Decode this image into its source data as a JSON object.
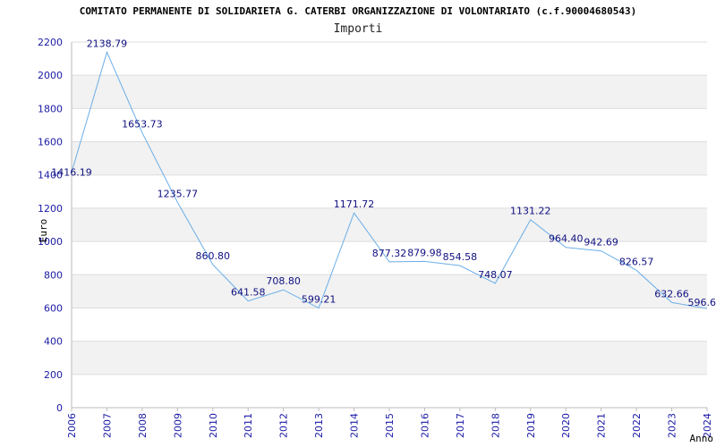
{
  "header": {
    "title": "COMITATO PERMANENTE DI SOLIDARIETA G. CATERBI ORGANIZZAZIONE DI VOLONTARIATO (c.f.90004680543)",
    "subtitle": "Importi"
  },
  "colors": {
    "line": "#6aaee8",
    "band": "#f2f2f2",
    "grid": "#dddddd",
    "tick_text": "#1a1aa6",
    "data_label": "#101080"
  },
  "chart_data": {
    "type": "line",
    "title": "COMITATO PERMANENTE DI SOLIDARIETA G. CATERBI ORGANIZZAZIONE DI VOLONTARIATO (c.f.90004680543)",
    "subtitle": "Importi",
    "xlabel": "Anno",
    "ylabel": "Euro",
    "ylim": [
      0,
      2200
    ],
    "yticks": [
      0,
      200,
      400,
      600,
      800,
      1000,
      1200,
      1400,
      1600,
      1800,
      2000,
      2200
    ],
    "categories": [
      "2006",
      "2007",
      "2008",
      "2009",
      "2010",
      "2011",
      "2012",
      "2013",
      "2014",
      "2015",
      "2016",
      "2017",
      "2018",
      "2019",
      "2020",
      "2021",
      "2022",
      "2023",
      "2024"
    ],
    "values": [
      1416.19,
      2138.79,
      1653.73,
      1235.77,
      860.8,
      641.58,
      708.8,
      599.21,
      1171.72,
      877.32,
      879.98,
      854.58,
      748.07,
      1131.22,
      964.4,
      942.69,
      826.57,
      632.66,
      596.6
    ],
    "data_labels": [
      "1416.19",
      "2138.79",
      "1653.73",
      "1235.77",
      "860.80",
      "641.58",
      "708.80",
      "599.21",
      "1171.72",
      "877.32",
      "879.98",
      "854.58",
      "748.07",
      "1131.22",
      "964.40",
      "942.69",
      "826.57",
      "632.66",
      "596.6"
    ],
    "grid": true,
    "legend": "none"
  }
}
